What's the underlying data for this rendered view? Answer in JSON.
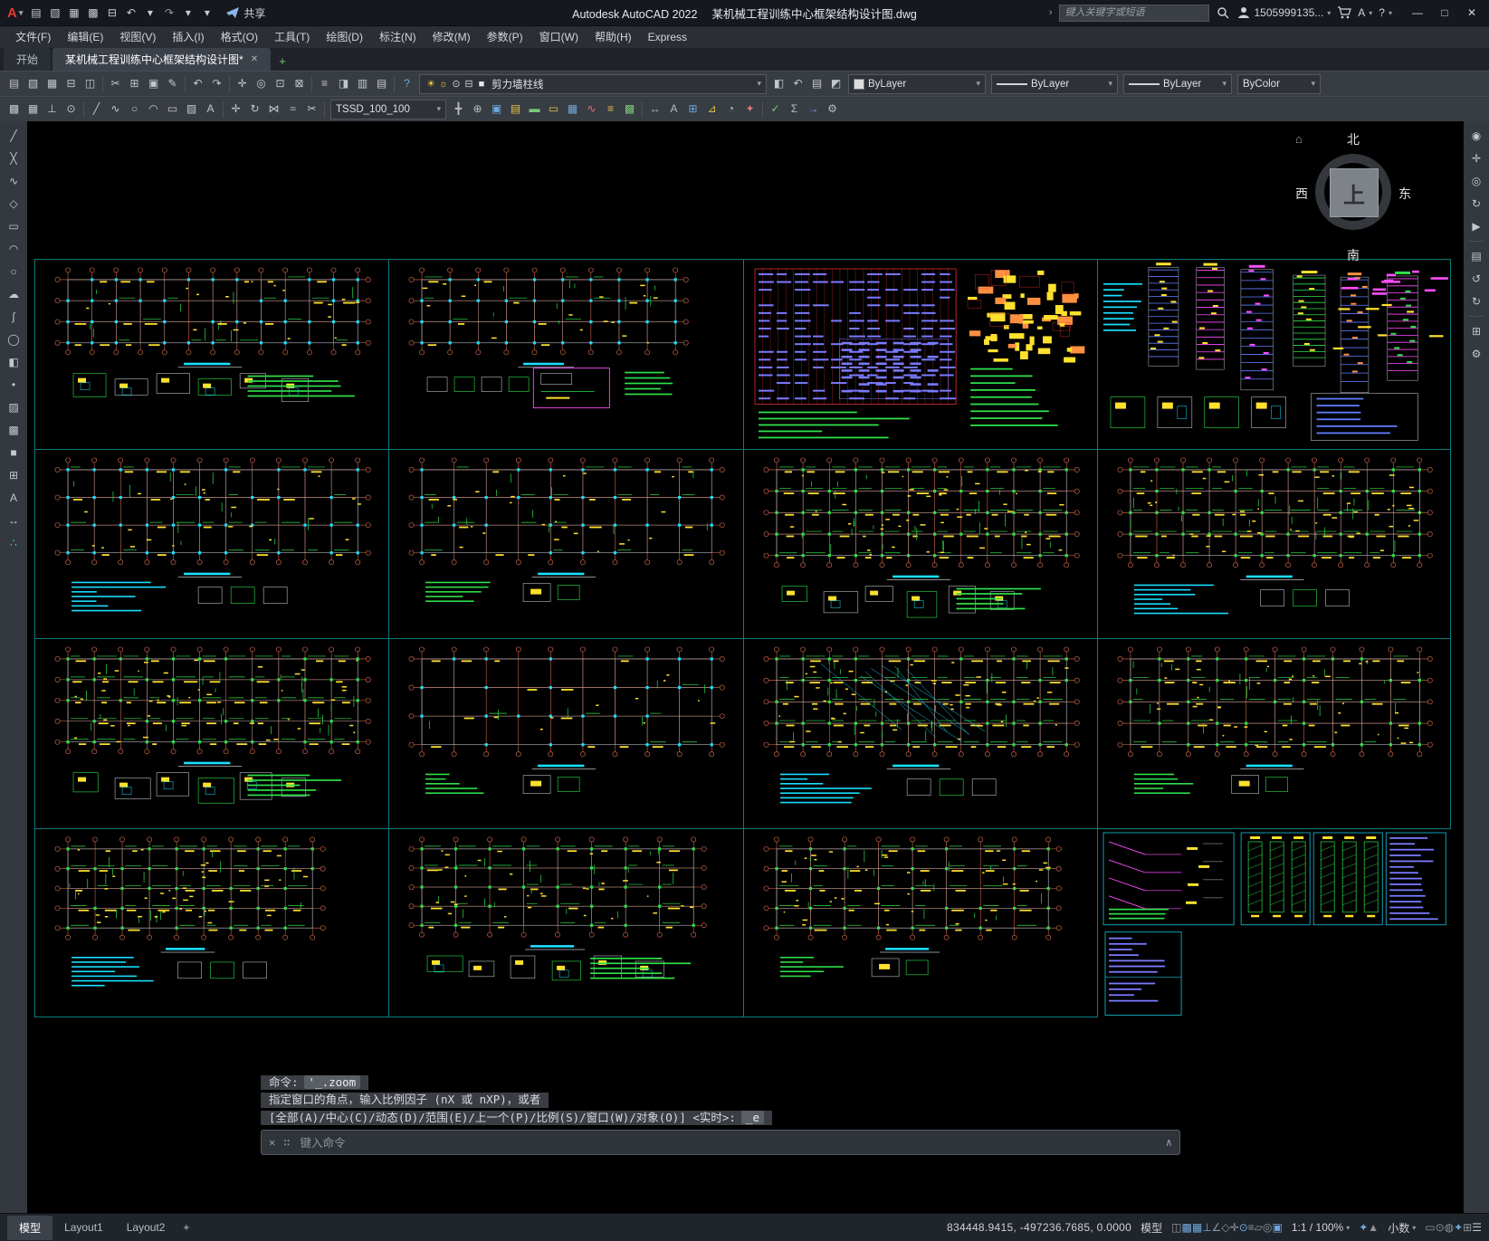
{
  "title_bar": {
    "logo_text": "A",
    "app_title": "Autodesk AutoCAD 2022",
    "doc_title": "某机械工程训练中心框架结构设计图.dwg",
    "share_label": "共享",
    "search_placeholder": "键入关键字或短语",
    "account_name": "1505999135...",
    "assistant_label": "A",
    "help_label": "?"
  },
  "window_controls": {
    "minimize": "—",
    "maximize": "□",
    "close": "✕"
  },
  "quick_access_icons": [
    [
      "new-file-icon",
      "▤"
    ],
    [
      "open-file-icon",
      "▧"
    ],
    [
      "save-icon",
      "▦"
    ],
    [
      "save-as-icon",
      "▩"
    ],
    [
      "plot-icon",
      "⊟"
    ],
    [
      "undo-icon",
      "↶"
    ],
    [
      "undo-caret-icon",
      "▾"
    ],
    [
      "redo-icon",
      "↷",
      "#8f959c"
    ],
    [
      "redo-caret-icon",
      "▾"
    ],
    [
      "qat-more-icon",
      "▾"
    ]
  ],
  "menu_items": [
    "文件(F)",
    "编辑(E)",
    "视图(V)",
    "插入(I)",
    "格式(O)",
    "工具(T)",
    "绘图(D)",
    "标注(N)",
    "修改(M)",
    "参数(P)",
    "窗口(W)",
    "帮助(H)",
    "Express"
  ],
  "file_tabs": {
    "start": "开始",
    "document": "某机械工程训练中心框架结构设计图*",
    "close_glyph": "✕",
    "new_tab_glyph": "+"
  },
  "toolbar_row1": {
    "icons_left": [
      [
        "qnew-icon",
        "▤"
      ],
      [
        "open-icon",
        "▧"
      ],
      [
        "save-icon",
        "▦"
      ],
      [
        "plot-icon",
        "⊟"
      ],
      [
        "preview-icon",
        "◫"
      ],
      [
        "separator"
      ],
      [
        "cut-icon",
        "✂"
      ],
      [
        "copy-icon",
        "⊞"
      ],
      [
        "paste-icon",
        "▣"
      ],
      [
        "match-properties-icon",
        "✎"
      ],
      [
        "separator"
      ],
      [
        "undo-icon",
        "↶"
      ],
      [
        "redo-icon",
        "↷"
      ],
      [
        "separator"
      ],
      [
        "pan-icon",
        "✛"
      ],
      [
        "zoom-realtime-icon",
        "◎"
      ],
      [
        "zoom-window-icon",
        "⊡"
      ],
      [
        "zoom-previous-icon",
        "⊠"
      ],
      [
        "separator"
      ],
      [
        "properties-icon",
        "≡"
      ],
      [
        "designcenter-icon",
        "◨"
      ],
      [
        "tool-palettes-icon",
        "▥"
      ],
      [
        "sheet-set-icon",
        "▤"
      ],
      [
        "separator"
      ],
      [
        "help-icon",
        "?",
        "#6fa8dc"
      ]
    ],
    "layer_combo": {
      "icons": [
        [
          "layer-bulb-icon",
          "☀",
          "#ffd23e"
        ],
        [
          "layer-freeze-icon",
          "☼",
          "#ffd23e"
        ],
        [
          "layer-lock-icon",
          "⊙",
          "#c8cdd2"
        ],
        [
          "layer-plot-icon",
          "⊟",
          "#c8cdd2"
        ],
        [
          "layer-color-swatch-icon",
          "■",
          "#e8e8e8"
        ]
      ],
      "label": "剪力墙柱线"
    },
    "icons_right": [
      [
        "layer-make-current-icon",
        "◧"
      ],
      [
        "layer-previous-icon",
        "↶"
      ],
      [
        "layer-states-icon",
        "▤"
      ],
      [
        "layer-isolate-icon",
        "◩"
      ]
    ],
    "combos": [
      {
        "name": "color-combo",
        "cls": "c-color",
        "swatch": "#dcdcdc",
        "label": "ByLayer"
      },
      {
        "name": "linetype-combo",
        "cls": "c-linetype",
        "line": true,
        "label": "ByLayer"
      },
      {
        "name": "lineweight-combo",
        "cls": "c-lineweight",
        "line": true,
        "label": "ByLayer"
      },
      {
        "name": "plotstyle-combo",
        "cls": "c-plotstyle",
        "label": "ByColor"
      }
    ]
  },
  "toolbar_row2": {
    "icons_left": [
      [
        "snap-toggle-icon",
        "▩"
      ],
      [
        "grid-toggle-icon",
        "▦"
      ],
      [
        "ortho-toggle-icon",
        "⊥"
      ],
      [
        "osnap-toggle-icon",
        "⊙"
      ],
      [
        "separator"
      ],
      [
        "line-icon",
        "╱"
      ],
      [
        "polyline-icon",
        "∿"
      ],
      [
        "circle-icon",
        "○"
      ],
      [
        "arc-icon",
        "◠"
      ],
      [
        "rect-icon",
        "▭"
      ],
      [
        "hatch-icon",
        "▨"
      ],
      [
        "text-icon",
        "A"
      ],
      [
        "separator"
      ],
      [
        "move-icon",
        "✛"
      ],
      [
        "rotate-icon",
        "↻"
      ],
      [
        "mirror-icon",
        "⋈"
      ],
      [
        "offset-icon",
        "≈"
      ],
      [
        "trim-icon",
        "✂"
      ],
      [
        "separator"
      ]
    ],
    "tssd_combo": {
      "label": "TSSD_100_100"
    },
    "icons_right": [
      [
        "tssd-axis-grid-icon",
        "╋",
        "#b8bcc2"
      ],
      [
        "tssd-axis-label-icon",
        "⊕",
        "#b8bcc2"
      ],
      [
        "tssd-column-icon",
        "▣",
        "#6fa8dc"
      ],
      [
        "tssd-column-section-icon",
        "▤",
        "#e4c44a"
      ],
      [
        "tssd-beam-icon",
        "▬",
        "#7ac87a"
      ],
      [
        "tssd-beam-section-icon",
        "▭",
        "#e4c44a"
      ],
      [
        "tssd-slab-icon",
        "▦",
        "#6fa8dc"
      ],
      [
        "tssd-rebar-icon",
        "∿",
        "#d87a7a"
      ],
      [
        "tssd-stair-icon",
        "≡",
        "#e4c44a"
      ],
      [
        "tssd-foundation-icon",
        "▩",
        "#7ac87a"
      ],
      [
        "separator"
      ],
      [
        "tssd-dim-icon",
        "↔",
        "#b8bcc2"
      ],
      [
        "tssd-text-icon",
        "A",
        "#b8bcc2"
      ],
      [
        "tssd-table-icon",
        "⊞",
        "#6fa8dc"
      ],
      [
        "tssd-section-icon",
        "⊿",
        "#e4c44a"
      ],
      [
        "tssd-detail-icon",
        "◔",
        "#b8bcc2"
      ],
      [
        "tssd-symbol-icon",
        "✦",
        "#d87a7a"
      ],
      [
        "separator"
      ],
      [
        "tssd-check-icon",
        "✓",
        "#7ac87a"
      ],
      [
        "tssd-calc-icon",
        "Σ",
        "#b8bcc2"
      ],
      [
        "tssd-export-icon",
        "→",
        "#6fa8dc"
      ],
      [
        "tssd-settings-icon",
        "⚙",
        "#b8bcc2"
      ]
    ]
  },
  "left_toolbar_icons": [
    [
      "line-tool-icon",
      "╱"
    ],
    [
      "xline-tool-icon",
      "╳"
    ],
    [
      "polyline-tool-icon",
      "∿"
    ],
    [
      "polygon-tool-icon",
      "◇"
    ],
    [
      "rect-tool-icon",
      "▭"
    ],
    [
      "arc-tool-icon",
      "◠"
    ],
    [
      "circle-tool-icon",
      "○"
    ],
    [
      "revcloud-tool-icon",
      "☁"
    ],
    [
      "spline-tool-icon",
      "∫"
    ],
    [
      "ellipse-tool-icon",
      "◯"
    ],
    [
      "insert-block-icon",
      "◧"
    ],
    [
      "point-tool-icon",
      "•"
    ],
    [
      "hatch-tool-icon",
      "▨"
    ],
    [
      "gradient-tool-icon",
      "▩"
    ],
    [
      "region-tool-icon",
      "■"
    ],
    [
      "table-tool-icon",
      "⊞"
    ],
    [
      "mtext-tool-icon",
      "A"
    ],
    [
      "dim-tool-icon",
      "↔"
    ],
    [
      "palette-dots-icon",
      "∴",
      "#19e0ff"
    ]
  ],
  "right_toolbar_icons": [
    [
      "fullnav-wheel-icon",
      "◉"
    ],
    [
      "pan-tool-icon",
      "✛"
    ],
    [
      "zoom-tool-icon",
      "◎"
    ],
    [
      "orbit-tool-icon",
      "↻"
    ],
    [
      "showmotion-icon",
      "▶"
    ],
    [
      "separator"
    ],
    [
      "layer-walk-icon",
      "▤"
    ],
    [
      "view-back-icon",
      "↺"
    ],
    [
      "view-forward-icon",
      "↻"
    ],
    [
      "separator"
    ],
    [
      "fullscreen-icon",
      "⊞"
    ],
    [
      "settings-icon",
      "⚙"
    ]
  ],
  "viewcube": {
    "north": "北",
    "south": "南",
    "east": "东",
    "west": "西",
    "top": "上"
  },
  "command_palette": {
    "line1_label": "命令:",
    "line1_token": "'_.zoom",
    "line2": "指定窗口的角点，输入比例因子 (nX 或 nXP)，或者",
    "line3": "[全部(A)/中心(C)/动态(D)/范围(E)/上一个(P)/比例(S)/窗口(W)/对象(O)] <实时>:",
    "line3_token": "_e",
    "input_placeholder": "键入命令"
  },
  "status_bar": {
    "layout_tabs": [
      {
        "name": "model",
        "label": "模型",
        "active": true
      },
      {
        "name": "layout1",
        "label": "Layout1",
        "active": false
      },
      {
        "name": "layout2",
        "label": "Layout2",
        "active": false
      },
      {
        "name": "new",
        "label": "+",
        "active": false
      }
    ],
    "coordinates": "834448.9415, -497236.7685, 0.0000",
    "model_toggle": "模型",
    "toggle_icons": [
      [
        "infer-constraints-icon",
        "◫",
        "#8f959c"
      ],
      [
        "snap-icon",
        "▩",
        "#6fa8dc"
      ],
      [
        "grid-icon",
        "▦",
        "#6fa8dc"
      ],
      [
        "ortho-icon",
        "⊥",
        "#6fa8dc"
      ],
      [
        "polar-icon",
        "∠",
        "#8f959c"
      ],
      [
        "isodraft-icon",
        "◇",
        "#8f959c"
      ],
      [
        "otrack-icon",
        "✛",
        "#8f959c"
      ],
      [
        "osnap-icon",
        "⊙",
        "#6fa8dc"
      ],
      [
        "lineweight-icon",
        "≡",
        "#8f959c"
      ],
      [
        "transparency-icon",
        "▱",
        "#8f959c"
      ],
      [
        "selection-cycle-icon",
        "◎",
        "#8f959c"
      ],
      [
        "dynamic-input-icon",
        "▣",
        "#6fa8dc"
      ]
    ],
    "annotation_scale": "1:1 / 100%",
    "annotation_icons": [
      [
        "annotation-visibility-icon",
        "✦",
        "#6fa8dc"
      ],
      [
        "annotation-autoscale-icon",
        "▲",
        "#8f959c"
      ]
    ],
    "units": "小数",
    "right_icons": [
      [
        "quick-properties-icon",
        "▭",
        "#8f959c"
      ],
      [
        "lock-ui-icon",
        "⊙",
        "#8f959c"
      ],
      [
        "isolate-objects-icon",
        "◍",
        "#8f959c"
      ],
      [
        "graphics-performance-icon",
        "✦",
        "#6fa8dc"
      ],
      [
        "clean-screen-icon",
        "⊞",
        "#8f959c"
      ],
      [
        "customize-icon",
        "☰",
        "#c3c8ce"
      ]
    ]
  },
  "canvas_panels": [
    {
      "type": "plan",
      "seed": 11,
      "cols": 13,
      "rows": 4,
      "ph": 70,
      "density": 0.8,
      "det": "blocks"
    },
    {
      "type": "plan",
      "seed": 22,
      "cols": 10,
      "rows": 4,
      "ph": 70,
      "pw": 280,
      "density": 0.7,
      "det": "magenta"
    },
    {
      "type": "schedule",
      "seed": 33
    },
    {
      "type": "strips",
      "seed": 44
    },
    {
      "type": "plan",
      "seed": 55,
      "cols": 12,
      "rows": 4,
      "ph": 92,
      "density": 1.0,
      "det": "text"
    },
    {
      "type": "plan",
      "seed": 66,
      "cols": 10,
      "rows": 4,
      "ph": 92,
      "density": 0.9,
      "det": "small"
    },
    {
      "type": "plan",
      "seed": 77,
      "cols": 12,
      "rows": 5,
      "ph": 95,
      "density": 1.9,
      "det": "blocks"
    },
    {
      "type": "plan",
      "seed": 88,
      "cols": 12,
      "rows": 5,
      "ph": 95,
      "density": 1.8,
      "det": "text"
    },
    {
      "type": "plan",
      "seed": 99,
      "cols": 12,
      "rows": 5,
      "ph": 92,
      "density": 1.9,
      "det": "blocks"
    },
    {
      "type": "plan",
      "seed": 110,
      "cols": 10,
      "rows": 4,
      "ph": 95,
      "density": 0.45,
      "det": "small"
    },
    {
      "type": "plan",
      "seed": 121,
      "cols": 12,
      "rows": 5,
      "ph": 95,
      "density": 2.0,
      "diag": true,
      "det": "text"
    },
    {
      "type": "plan",
      "seed": 132,
      "cols": 11,
      "rows": 5,
      "ph": 95,
      "density": 1.6,
      "det": "small"
    },
    {
      "type": "plan",
      "seed": 143,
      "cols": 10,
      "rows": 5,
      "ph": 88,
      "pw": 270,
      "density": 1.5,
      "det": "text"
    },
    {
      "type": "plan",
      "seed": 154,
      "cols": 9,
      "rows": 5,
      "ph": 85,
      "pw": 300,
      "density": 1.4,
      "det": "blocks"
    },
    {
      "type": "plan",
      "seed": 165,
      "cols": 9,
      "rows": 5,
      "ph": 88,
      "pw": 300,
      "density": 1.5,
      "det": "small"
    },
    {
      "type": "details",
      "seed": 176
    }
  ]
}
